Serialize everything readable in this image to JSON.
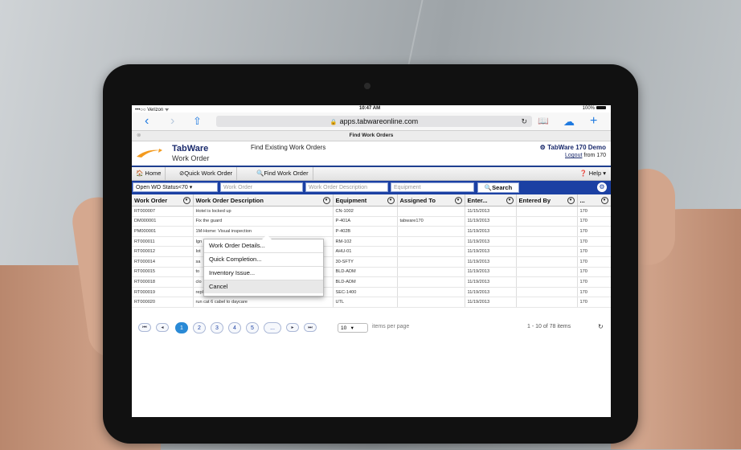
{
  "device": {
    "status": {
      "carrier": "•••○○ Verizon ᯤ",
      "time": "10:47 AM",
      "battery": "100%"
    },
    "browser": {
      "back": "‹",
      "forward": "›",
      "share": "⇧",
      "url": "apps.tabwareonline.com",
      "reload": "↻",
      "bookmarks": "📖",
      "cloud": "☁",
      "new_tab": "+",
      "tab_title": "Find Work Orders"
    }
  },
  "app": {
    "brand": "TabWare",
    "brand_sub": "Work Order",
    "page_heading": "Find Existing Work Orders",
    "demo_label": "TabWare 170 Demo",
    "logout_label": "Logout",
    "logout_suffix": "from 170",
    "accent_color": "#1b40a3"
  },
  "menu": {
    "home": "🏠 Home",
    "quick_work_order": "⊘Quick Work Order",
    "find_work_order": "🔍Find Work Order",
    "help": "❓ Help ▾"
  },
  "filters": {
    "status_select": "Open WO Status<70",
    "work_order_placeholder": "Work Order",
    "description_placeholder": "Work Order Description",
    "equipment_placeholder": "Equipment",
    "search_label": "🔍Search"
  },
  "grid": {
    "columns": [
      "Work Order",
      "Work Order Description",
      "Equipment",
      "Assigned To",
      "Enter...",
      "Entered By",
      "..."
    ],
    "rows": [
      [
        "RT000007",
        "Hotel is locked up",
        "CN-1002",
        "",
        "11/15/2013",
        "",
        "170"
      ],
      [
        "DM000001",
        "Fix the guard",
        "P-401A",
        "tabware170",
        "11/19/2013",
        "",
        "170"
      ],
      [
        "PM000001",
        "1M-Home: Visual inspection",
        "P-402B",
        "",
        "11/19/2013",
        "",
        "170"
      ],
      [
        "RT000011",
        "Ign",
        "RM-102",
        "",
        "11/19/2013",
        "",
        "170"
      ],
      [
        "RT000012",
        "Iot",
        "AHU-01",
        "",
        "11/19/2013",
        "",
        "170"
      ],
      [
        "RT000014",
        "sa",
        "30-SFTY",
        "",
        "11/19/2013",
        "",
        "170"
      ],
      [
        "RT000015",
        "to",
        "BLD-ADM",
        "",
        "11/19/2013",
        "",
        "170"
      ],
      [
        "RT000018",
        "clo",
        "BLD-ADM",
        "",
        "11/19/2013",
        "",
        "170"
      ],
      [
        "RT000019",
        "replace fan belt",
        "SEC-1400",
        "",
        "11/19/2013",
        "",
        "170"
      ],
      [
        "RT000020",
        "run cat 6 cabel to daycare",
        "UTL",
        "",
        "11/19/2013",
        "",
        "170"
      ]
    ]
  },
  "context_menu": {
    "items": [
      "Work Order Details...",
      "Quick Completion...",
      "Inventory Issue...",
      "Cancel"
    ]
  },
  "pager": {
    "first": "⏮",
    "prev": "◂",
    "pages": [
      "1",
      "2",
      "3",
      "4",
      "5",
      "..."
    ],
    "next": "▸",
    "last": "⏭",
    "per_page": "10",
    "per_page_label": "items per page",
    "info": "1 - 10 of 78 items",
    "refresh": "↻"
  }
}
